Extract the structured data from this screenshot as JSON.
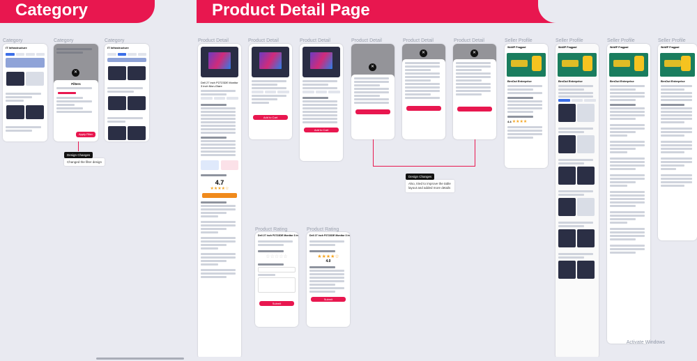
{
  "banners": {
    "category": "Category",
    "product_detail": "Product Detail Page"
  },
  "screen_labels": {
    "category": [
      "Category",
      "Category",
      "Category"
    ],
    "product_detail": [
      "Product Detail",
      "Product Detail",
      "Product Detail",
      "Product Detail",
      "Product Detail",
      "Product Detail"
    ],
    "seller_profile": [
      "Seller Profile",
      "Seller Profile",
      "Seller Profile",
      "Seller Profile"
    ],
    "product_rating": [
      "Product Rating",
      "Product Rating"
    ]
  },
  "category_screen": {
    "title": "IT Infrastructure",
    "badge": "16"
  },
  "filters": {
    "title": "Filters",
    "apply": "Apply Filter"
  },
  "tooltips": {
    "design_changes_a": "Design Changes",
    "design_changes_b": "Design Changes"
  },
  "notes": {
    "change_a": "Changed the filter design",
    "change_b": "Also, tried to improve the table layout and added more details"
  },
  "product": {
    "title": "Dell 27 inch P2723DE Monitor 3 inch Mon-Glare",
    "monitor_label": "#1 in India",
    "rating": "4.7",
    "add_to_cart": "Add to Cart"
  },
  "seller": {
    "name": "BrnOut Enterprise",
    "store": "WoWP Fragpad",
    "rating": "4.4"
  },
  "rating_screen": {
    "title": "Dell 27 inch P2723DE Monitor 3 inch...",
    "score": "4.0",
    "submit": "Submit"
  },
  "system": {
    "watermark": "Activate Windows"
  },
  "colors": {
    "brand": "#e8174f",
    "accent": "#3c6fe8",
    "sale_bg": "#1a7d5e",
    "cta_orange": "#f08a1c"
  }
}
